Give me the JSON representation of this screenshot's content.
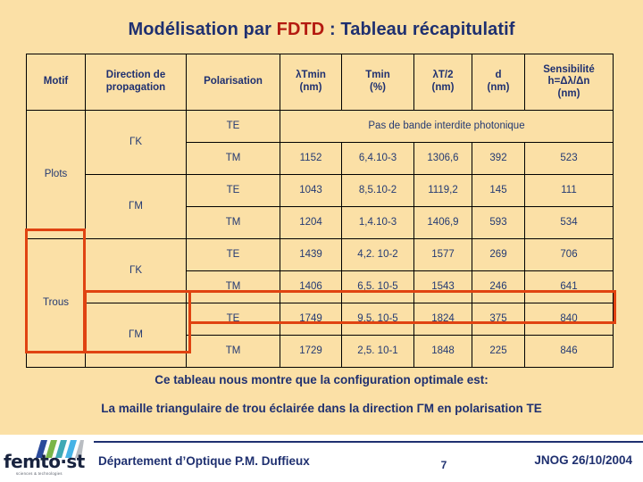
{
  "slide": {
    "background_color": "#fbe0a6",
    "footer_background_color": "#ffffff",
    "title_color": "#1f3070",
    "accent_color": "#b41a10",
    "highlight_color": "#e04311"
  },
  "title": {
    "before": "Modélisation par ",
    "accent": "FDTD",
    "after": " : Tableau récapitulatif"
  },
  "table": {
    "headers": [
      "Motif",
      "Direction de propagation",
      "Polarisation",
      "λTmin (nm)",
      "Tmin (%)",
      "λT/2 (nm)",
      "d (nm)",
      "Sensibilité h=Δλ/Δn (nm)"
    ],
    "header_lines": {
      "motif": "Motif",
      "direction_l1": "Direction de",
      "direction_l2": "propagation",
      "polarisation": "Polarisation",
      "lambda_tmin_l1": "λTmin",
      "lambda_tmin_l2": "(nm)",
      "tmin_l1": "Tmin",
      "tmin_l2": "(%)",
      "lambda_t2_l1": "λT/2",
      "lambda_t2_l2": "(nm)",
      "d_l1": "d",
      "d_l2": "(nm)",
      "sens_l1": "Sensibilité",
      "sens_l2": "h=Δλ/Δn",
      "sens_l3": "(nm)"
    },
    "merged_note": "Pas de bande interdite photonique",
    "motifs": [
      {
        "label": "Plots"
      },
      {
        "label": "Trous"
      }
    ],
    "directions": [
      {
        "label": "ΓK"
      },
      {
        "label": "ΓM"
      },
      {
        "label": "ΓK"
      },
      {
        "label": "ΓM"
      }
    ],
    "rows": [
      {
        "motif": "Plots",
        "direction": "ΓK",
        "polarisation": "TE",
        "merged": true,
        "merged_text": "Pas de bande interdite photonique",
        "lambda_tmin": "",
        "tmin": "",
        "lambda_t2": "",
        "d": "",
        "sensibilite": ""
      },
      {
        "motif": "Plots",
        "direction": "ΓK",
        "polarisation": "TM",
        "merged": false,
        "lambda_tmin": "1152",
        "tmin": "6,4.10-3",
        "lambda_t2": "1306,6",
        "d": "392",
        "sensibilite": "523"
      },
      {
        "motif": "Plots",
        "direction": "ΓM",
        "polarisation": "TE",
        "merged": false,
        "lambda_tmin": "1043",
        "tmin": "8,5.10-2",
        "lambda_t2": "1119,2",
        "d": "145",
        "sensibilite": "111"
      },
      {
        "motif": "Plots",
        "direction": "ΓM",
        "polarisation": "TM",
        "merged": false,
        "lambda_tmin": "1204",
        "tmin": "1,4.10-3",
        "lambda_t2": "1406,9",
        "d": "593",
        "sensibilite": "534"
      },
      {
        "motif": "Trous",
        "direction": "ΓK",
        "polarisation": "TE",
        "merged": false,
        "lambda_tmin": "1439",
        "tmin": "4,2. 10-2",
        "lambda_t2": "1577",
        "d": "269",
        "sensibilite": "706"
      },
      {
        "motif": "Trous",
        "direction": "ΓK",
        "polarisation": "TM",
        "merged": false,
        "lambda_tmin": "1406",
        "tmin": "6,5. 10-5",
        "lambda_t2": "1543",
        "d": "246",
        "sensibilite": "641"
      },
      {
        "motif": "Trous",
        "direction": "ΓM",
        "polarisation": "TE",
        "merged": false,
        "highlighted": true,
        "lambda_tmin": "1749",
        "tmin": "9,5. 10-5",
        "lambda_t2": "1824",
        "d": "375",
        "sensibilite": "840"
      },
      {
        "motif": "Trous",
        "direction": "ΓM",
        "polarisation": "TM",
        "merged": false,
        "lambda_tmin": "1729",
        "tmin": "2,5. 10-1",
        "lambda_t2": "1848",
        "d": "225",
        "sensibilite": "846"
      }
    ]
  },
  "conclusion": {
    "line1": "Ce tableau nous montre que la configuration optimale est:",
    "line2": "La maille triangulaire de trou éclairée dans la direction ΓM en polarisation TE"
  },
  "footer": {
    "logo_word": "femto·st",
    "logo_subtitle": "sciences & technologies",
    "department": "Département d’Optique P.M. Duffieux",
    "page_number": "7",
    "conference": "JNOG 26/10/2004",
    "logo_bar_colors": [
      "#2b4a9b",
      "#7ab648",
      "#3fa9b5",
      "#46b3e6",
      "#b9bdc2"
    ]
  }
}
